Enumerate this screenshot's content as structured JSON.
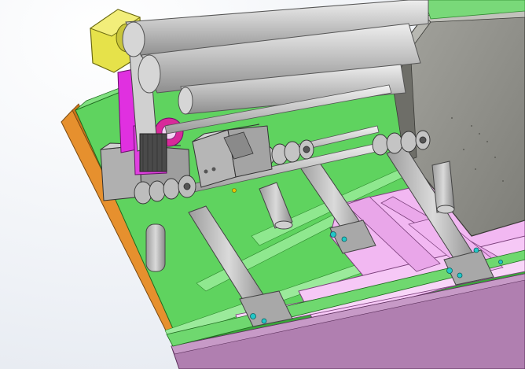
{
  "scene": {
    "colors": {
      "background": "#eef1f6",
      "base_plate_green": "#5fd35f",
      "base_plate_green_dark": "#3aa63a",
      "orange_edge": "#e6902e",
      "frame_pink": "#f2b8f2",
      "frame_purple": "#b07fb0",
      "roller_gray": "#c9c9c9",
      "housing_dark": "#8c8c86",
      "bearing_yellow": "#e6e24a",
      "magenta_part": "#e030e0",
      "cyan_bolt": "#22c7c7"
    }
  }
}
